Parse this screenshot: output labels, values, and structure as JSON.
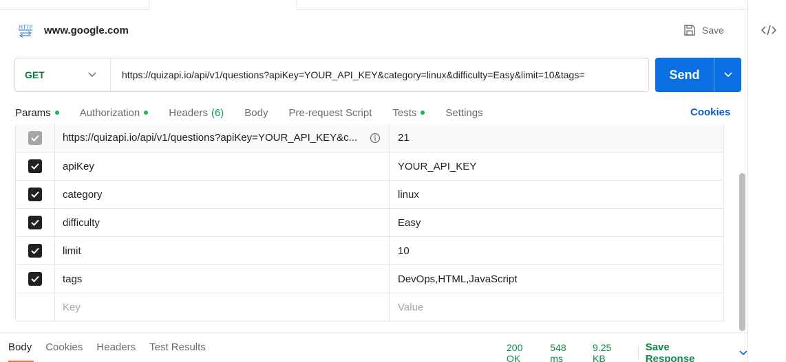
{
  "request": {
    "title": "www.google.com",
    "save_label": "Save",
    "method": "GET",
    "url": "https://quizapi.io/api/v1/questions?apiKey=YOUR_API_KEY&category=linux&difficulty=Easy&limit=10&tags=",
    "send_label": "Send"
  },
  "tabs": [
    {
      "label": "Params",
      "dot": true
    },
    {
      "label": "Authorization",
      "dot": true
    },
    {
      "label": "Headers",
      "count": "(6)"
    },
    {
      "label": "Body"
    },
    {
      "label": "Pre-request Script"
    },
    {
      "label": "Tests",
      "dot": true
    },
    {
      "label": "Settings"
    }
  ],
  "cookies_label": "Cookies",
  "params": {
    "first_row": {
      "key": "https://quizapi.io/api/v1/questions?apiKey=YOUR_API_KEY&c...",
      "value": "21"
    },
    "rows": [
      {
        "key": "apiKey",
        "value": "YOUR_API_KEY"
      },
      {
        "key": "category",
        "value": "linux"
      },
      {
        "key": "difficulty",
        "value": "Easy"
      },
      {
        "key": "limit",
        "value": "10"
      },
      {
        "key": "tags",
        "value": "DevOps,HTML,JavaScript"
      }
    ],
    "placeholder_key": "Key",
    "placeholder_value": "Value"
  },
  "response": {
    "tabs": [
      "Body",
      "Cookies",
      "Headers",
      "Test Results"
    ],
    "status": "200 OK",
    "time": "548 ms",
    "size": "9.25 KB",
    "save_label": "Save Response"
  },
  "colors": {
    "accent": "#ff6c37",
    "send": "#0a6fe3",
    "link": "#0b5fc4",
    "success": "#0e8a46"
  }
}
